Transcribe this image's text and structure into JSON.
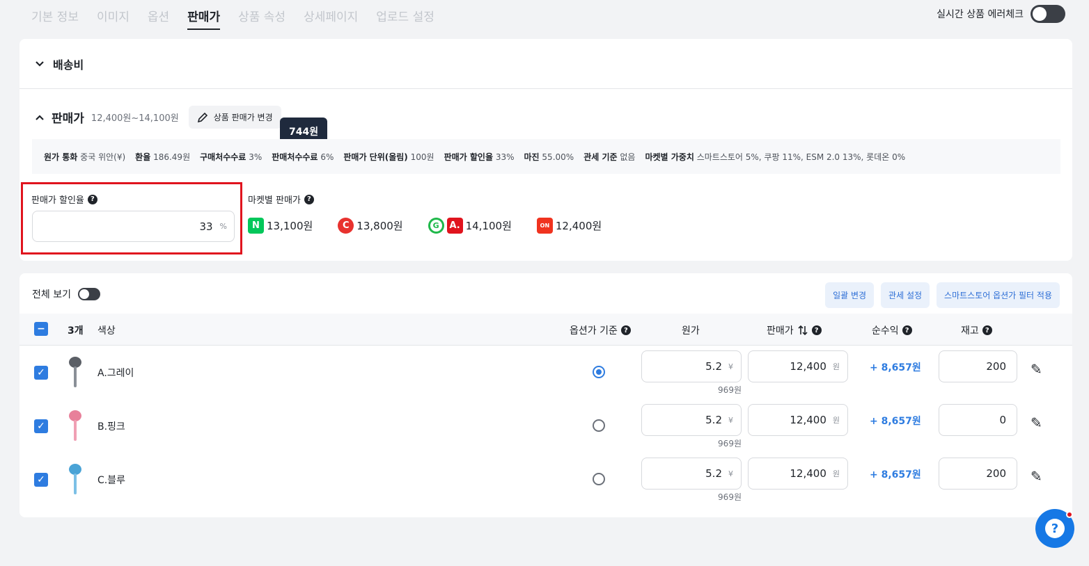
{
  "tabs": [
    "기본 정보",
    "이미지",
    "옵션",
    "판매가",
    "상품 속성",
    "상세페이지",
    "업로드 설정"
  ],
  "realtime_label": "실시간 상품 에러체크",
  "shipping": {
    "title": "배송비"
  },
  "price": {
    "title": "판매가",
    "range": "12,400원~14,100원",
    "change_button": "상품 판매가 변경",
    "tooltip": "744원"
  },
  "info": [
    {
      "k": "원가 통화",
      "v": "중국 위안(¥)"
    },
    {
      "k": "환율",
      "v": "186.49원"
    },
    {
      "k": "구매처수수료",
      "v": "3%"
    },
    {
      "k": "판매처수수료",
      "v": "6%"
    },
    {
      "k": "판매가 단위(올림)",
      "v": "100원"
    },
    {
      "k": "판매가 할인율",
      "v": "33%"
    },
    {
      "k": "마진",
      "v": "55.00%"
    },
    {
      "k": "관세 기준",
      "v": "없음"
    },
    {
      "k": "마켓별 가중치",
      "v": "스마트스토어 5%, 쿠팡 11%, ESM 2.0 13%, 롯데온 0%"
    }
  ],
  "discount": {
    "label": "판매가 할인율",
    "value": "33",
    "unit": "%"
  },
  "market": {
    "label": "마켓별 판매가",
    "prices": [
      {
        "icon": "naver-icon",
        "price": "13,100원",
        "color": "#03c75a"
      },
      {
        "icon": "coupang-icon",
        "price": "13,800원",
        "color": "#e8322e"
      },
      {
        "icon": "esm-icon",
        "price": "14,100원",
        "color": "#e0141e"
      },
      {
        "icon": "lotteon-icon",
        "price": "12,400원",
        "color": "#f0331f"
      }
    ]
  },
  "table": {
    "view_all": "전체 보기",
    "actions": [
      "일괄 변경",
      "관세 설정",
      "스마트스토어 옵션가 필터 적용"
    ],
    "count": "3개",
    "col_color": "색상",
    "col_option_base": "옵션가 기준",
    "col_cost": "원가",
    "col_price": "판매가",
    "col_profit": "순수익",
    "col_stock": "재고",
    "cost_unit": "¥",
    "price_unit": "원",
    "rows": [
      {
        "name": "A.그레이",
        "cost": "5.2",
        "cost_krw": "969원",
        "price": "12,400",
        "profit": "+ 8,657원",
        "stock": "200",
        "selected": true,
        "color": "#5b5f66"
      },
      {
        "name": "B.핑크",
        "cost": "5.2",
        "cost_krw": "969원",
        "price": "12,400",
        "profit": "+ 8,657원",
        "stock": "0",
        "selected": false,
        "color": "#e8809a"
      },
      {
        "name": "C.블루",
        "cost": "5.2",
        "cost_krw": "969원",
        "price": "12,400",
        "profit": "+ 8,657원",
        "stock": "200",
        "selected": false,
        "color": "#4aa3d6"
      }
    ]
  },
  "help_label": "?"
}
